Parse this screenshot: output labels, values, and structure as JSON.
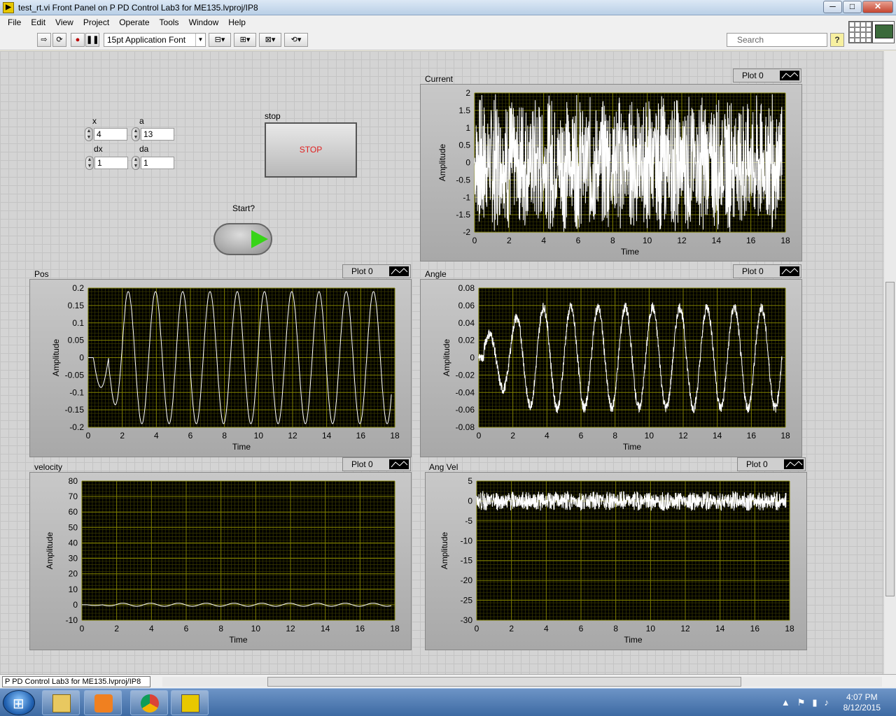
{
  "window": {
    "title": "test_rt.vi Front Panel on P PD Control Lab3 for ME135.lvproj/IP8",
    "min": "─",
    "max": "□",
    "close": "✕"
  },
  "menu": [
    "File",
    "Edit",
    "View",
    "Project",
    "Operate",
    "Tools",
    "Window",
    "Help"
  ],
  "toolbar": {
    "font": "15pt Application Font",
    "search_placeholder": "Search",
    "help": "?"
  },
  "controls": {
    "x": {
      "label": "x",
      "value": "4"
    },
    "a": {
      "label": "a",
      "value": "13"
    },
    "dx": {
      "label": "dx",
      "value": "1"
    },
    "da": {
      "label": "da",
      "value": "1"
    },
    "stop": {
      "label": "stop",
      "text": "STOP"
    },
    "start": {
      "label": "Start?"
    }
  },
  "colors": {
    "plot_bg": "#000000",
    "grid": "#7f7f00",
    "trace": "#ffffff",
    "panel": "#d4d4d4"
  },
  "chart_data": [
    {
      "id": "current",
      "type": "line",
      "title": "Current",
      "legend": "Plot 0",
      "xlabel": "Time",
      "ylabel": "Amplitude",
      "xlim": [
        0,
        18
      ],
      "ylim": [
        -2,
        2
      ],
      "xticks": [
        0,
        2,
        4,
        6,
        8,
        10,
        12,
        14,
        16,
        18
      ],
      "yticks": [
        2,
        1.5,
        1,
        0.5,
        0,
        -0.5,
        -1,
        -1.5,
        -2
      ],
      "ytick_labels": [
        "2",
        "1.5",
        "1",
        "0.5",
        "0",
        "-0.5",
        "-1",
        "-1.5",
        "-2"
      ],
      "series": [
        {
          "kind": "noise",
          "amp": 2,
          "xmax": 17.8
        }
      ]
    },
    {
      "id": "pos",
      "type": "line",
      "title": "Pos",
      "legend": "Plot 0",
      "xlabel": "Time",
      "ylabel": "Amplitude",
      "xlim": [
        0,
        18
      ],
      "ylim": [
        -0.2,
        0.2
      ],
      "xticks": [
        0,
        2,
        4,
        6,
        8,
        10,
        12,
        14,
        16,
        18
      ],
      "yticks": [
        0.2,
        0.15,
        0.1,
        0.05,
        0,
        -0.05,
        -0.1,
        -0.15,
        -0.2
      ],
      "ytick_labels": [
        "0.2",
        "0.15",
        "0.1",
        "0.05",
        "0",
        "-0.05",
        "-0.1",
        "-0.15",
        "-0.2"
      ],
      "series": [
        {
          "kind": "sine",
          "period": 1.6,
          "amp": 0.19,
          "xmax": 17.8
        }
      ]
    },
    {
      "id": "angle",
      "type": "line",
      "title": "Angle",
      "legend": "Plot 0",
      "xlabel": "Time",
      "ylabel": "Amplitude",
      "xlim": [
        0,
        18
      ],
      "ylim": [
        -0.08,
        0.08
      ],
      "xticks": [
        0,
        2,
        4,
        6,
        8,
        10,
        12,
        14,
        16,
        18
      ],
      "yticks": [
        0.08,
        0.06,
        0.04,
        0.02,
        0,
        -0.02,
        -0.04,
        -0.06,
        -0.08
      ],
      "ytick_labels": [
        "0.08",
        "0.06",
        "0.04",
        "0.02",
        "0",
        "-0.02",
        "-0.04",
        "-0.06",
        "-0.08"
      ],
      "series": [
        {
          "kind": "sine_noisy",
          "period": 1.6,
          "amp": 0.058,
          "xmax": 17.8
        }
      ]
    },
    {
      "id": "velocity",
      "type": "line",
      "title": "velocity",
      "legend": "Plot 0",
      "xlabel": "Time",
      "ylabel": "Amplitude",
      "xlim": [
        0,
        18
      ],
      "ylim": [
        -10,
        80
      ],
      "xticks": [
        0,
        2,
        4,
        6,
        8,
        10,
        12,
        14,
        16,
        18
      ],
      "yticks": [
        80,
        70,
        60,
        50,
        40,
        30,
        20,
        10,
        0,
        -10
      ],
      "ytick_labels": [
        "80",
        "70",
        "60",
        "50",
        "40",
        "30",
        "20",
        "10",
        "0",
        "-10"
      ],
      "series": [
        {
          "kind": "sine",
          "period": 1.6,
          "amp": 1,
          "xmax": 17.8
        }
      ]
    },
    {
      "id": "angvel",
      "type": "line",
      "title": "Ang Vel",
      "legend": "Plot 0",
      "xlabel": "Time",
      "ylabel": "Amplitude",
      "xlim": [
        0,
        18
      ],
      "ylim": [
        -30,
        5
      ],
      "xticks": [
        0,
        2,
        4,
        6,
        8,
        10,
        12,
        14,
        16,
        18
      ],
      "yticks": [
        5,
        0,
        -5,
        -10,
        -15,
        -20,
        -25,
        -30
      ],
      "ytick_labels": [
        "5",
        "0",
        "-5",
        "-10",
        "-15",
        "-20",
        "-25",
        "-30"
      ],
      "series": [
        {
          "kind": "noise",
          "amp": 2.5,
          "xmax": 17.8
        }
      ]
    }
  ],
  "status": {
    "path": "P PD Control Lab3 for ME135.lvproj/IP8"
  },
  "taskbar": {
    "time": "4:07 PM",
    "date": "8/12/2015"
  }
}
